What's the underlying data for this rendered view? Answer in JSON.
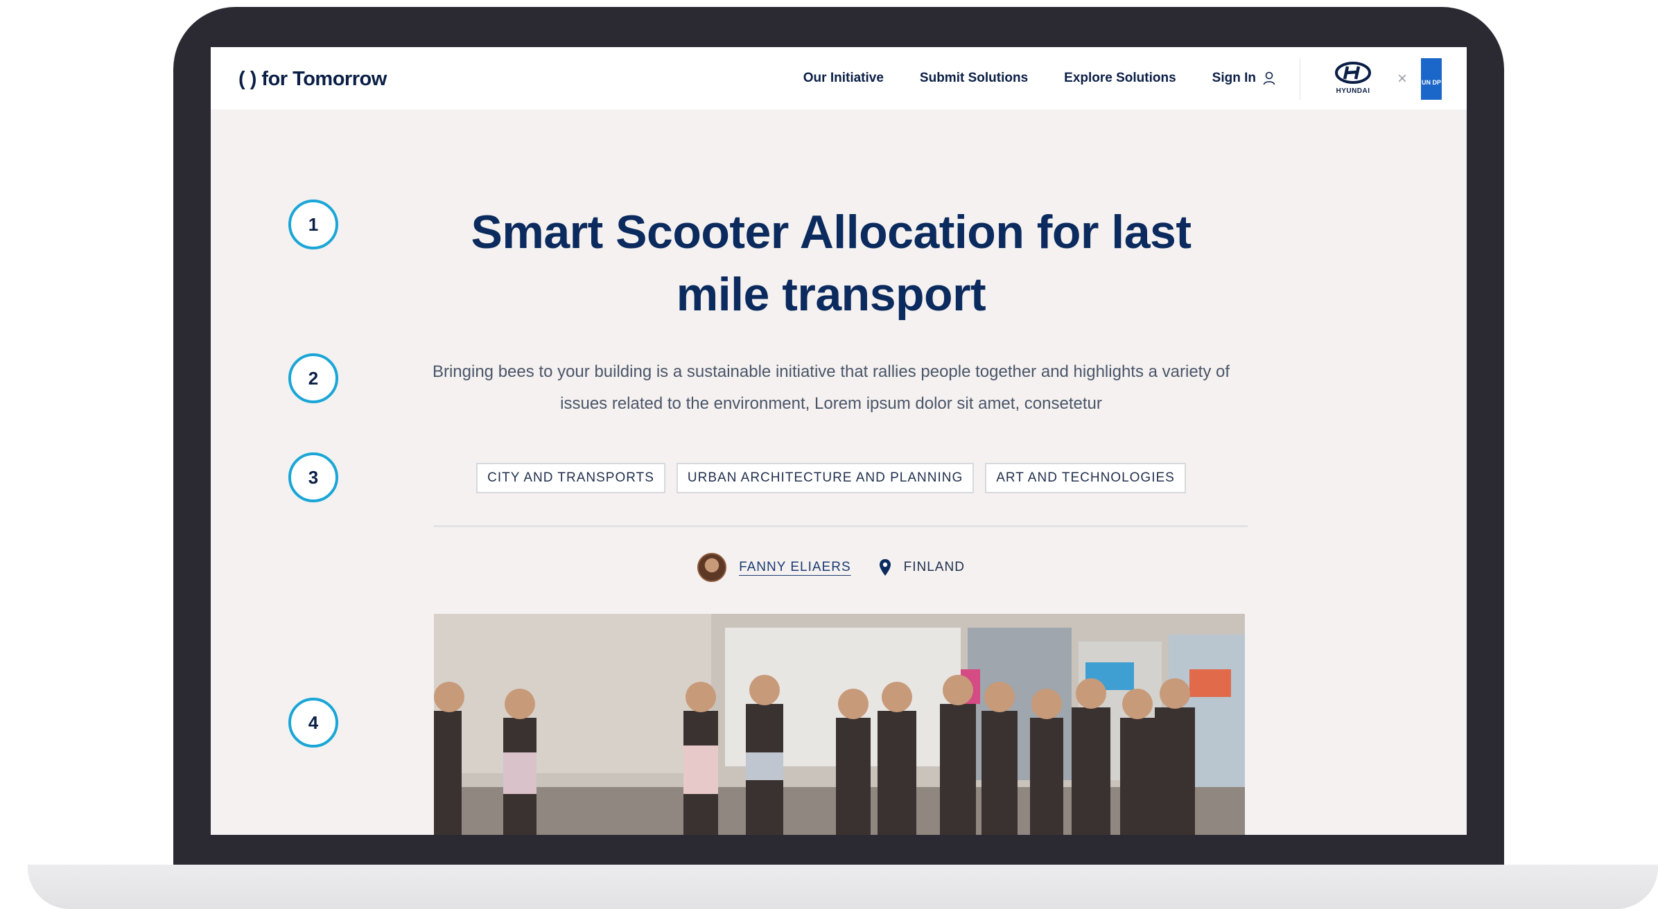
{
  "logo": {
    "text": "( ) for Tomorrow"
  },
  "nav": {
    "items": [
      {
        "label": "Our Initiative"
      },
      {
        "label": "Submit Solutions"
      },
      {
        "label": "Explore Solutions"
      }
    ],
    "sign_in": "Sign In",
    "partner_hyundai": "HYUNDAI",
    "close_glyph": "×",
    "partner_undp": "UN DP"
  },
  "markers": [
    "1",
    "2",
    "3",
    "4"
  ],
  "article": {
    "title": "Smart Scooter Allocation for last mile transport",
    "description": "Bringing bees to your building is a sustainable initiative that rallies people together and highlights a variety of issues related to the environment, Lorem ipsum dolor sit amet, consetetur",
    "tags": [
      "CITY AND TRANSPORTS",
      "URBAN ARCHITECTURE AND PLANNING",
      "ART AND TECHNOLOGIES"
    ],
    "author": "FANNY ELIAERS",
    "location": "FINLAND"
  },
  "colors": {
    "navy": "#0b2a5e",
    "accent_teal": "#1aa6d6",
    "page_bg": "#f4f1f0",
    "device": "#2b2a33"
  }
}
